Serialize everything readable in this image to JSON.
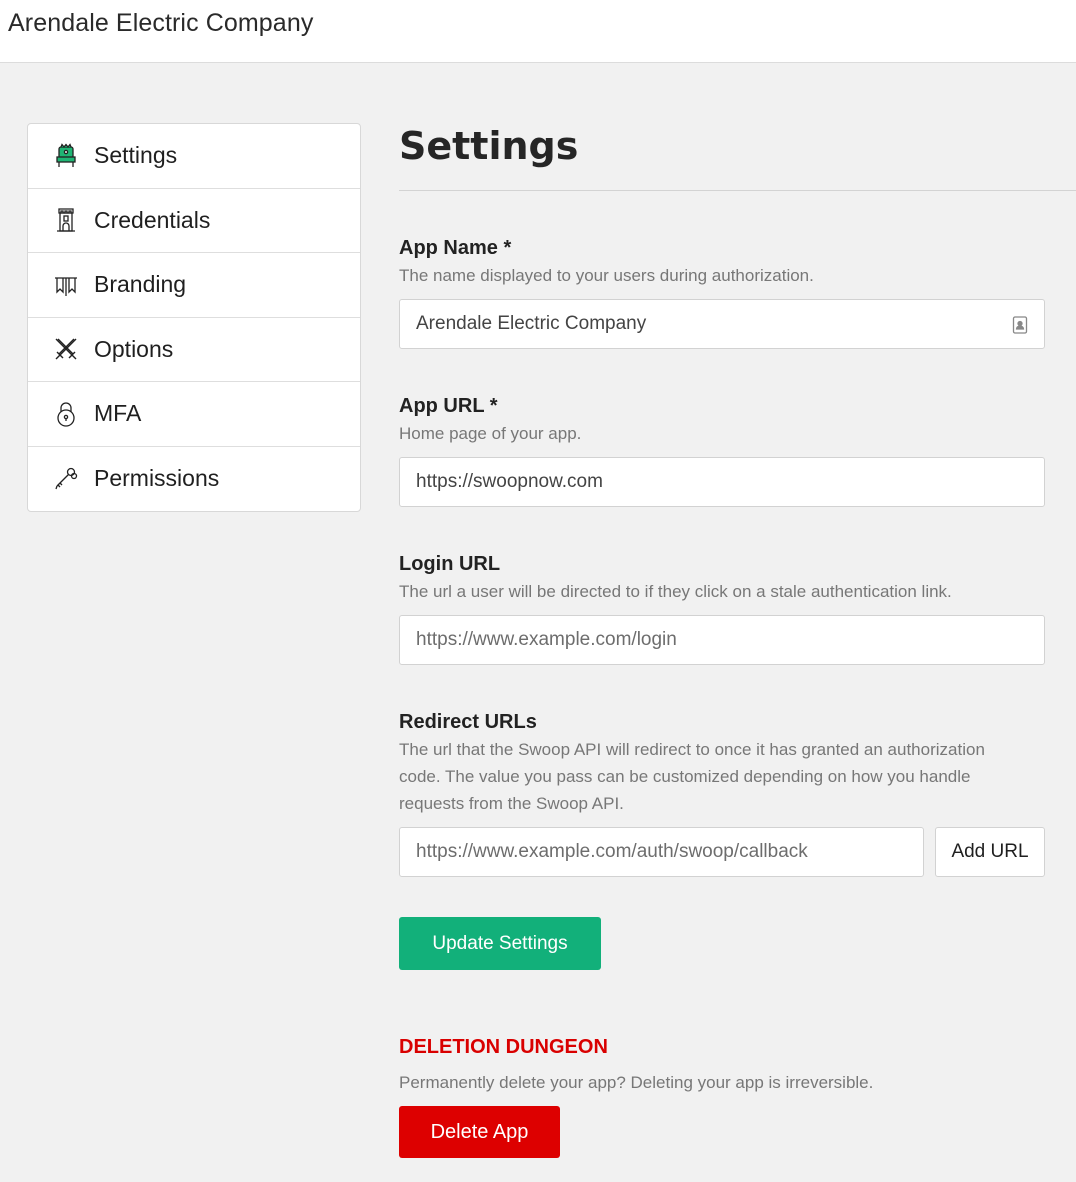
{
  "header": {
    "brand": "Arendale Electric Company"
  },
  "sidebar": {
    "items": [
      {
        "label": "Settings",
        "icon": "throne-icon",
        "active": true
      },
      {
        "label": "Credentials",
        "icon": "tower-icon"
      },
      {
        "label": "Branding",
        "icon": "banner-icon"
      },
      {
        "label": "Options",
        "icon": "crossed-swords-icon"
      },
      {
        "label": "MFA",
        "icon": "padlock-icon"
      },
      {
        "label": "Permissions",
        "icon": "keys-icon"
      }
    ]
  },
  "main": {
    "title": "Settings",
    "app_name": {
      "label": "App Name *",
      "help": "The name displayed to your users during authorization.",
      "value": "Arendale Electric Company"
    },
    "app_url": {
      "label": "App URL *",
      "help": "Home page of your app.",
      "value": "https://swoopnow.com"
    },
    "login_url": {
      "label": "Login URL",
      "help": "The url a user will be directed to if they click on a stale authentication link.",
      "placeholder": "https://www.example.com/login"
    },
    "redirect_urls": {
      "label": "Redirect URLs",
      "help": "The url that the Swoop API will redirect to once it has granted an authorization code. The value you pass can be customized depending on how you handle requests from the Swoop API.",
      "placeholder": "https://www.example.com/auth/swoop/callback",
      "add_label": "Add URL"
    },
    "update_label": "Update Settings",
    "danger": {
      "title": "DELETION DUNGEON",
      "help": "Permanently delete your app? Deleting your app is irreversible.",
      "delete_label": "Delete App"
    }
  },
  "colors": {
    "primary": "#12b07a",
    "danger": "#dd0000",
    "active_icon": "#1aa56a"
  }
}
